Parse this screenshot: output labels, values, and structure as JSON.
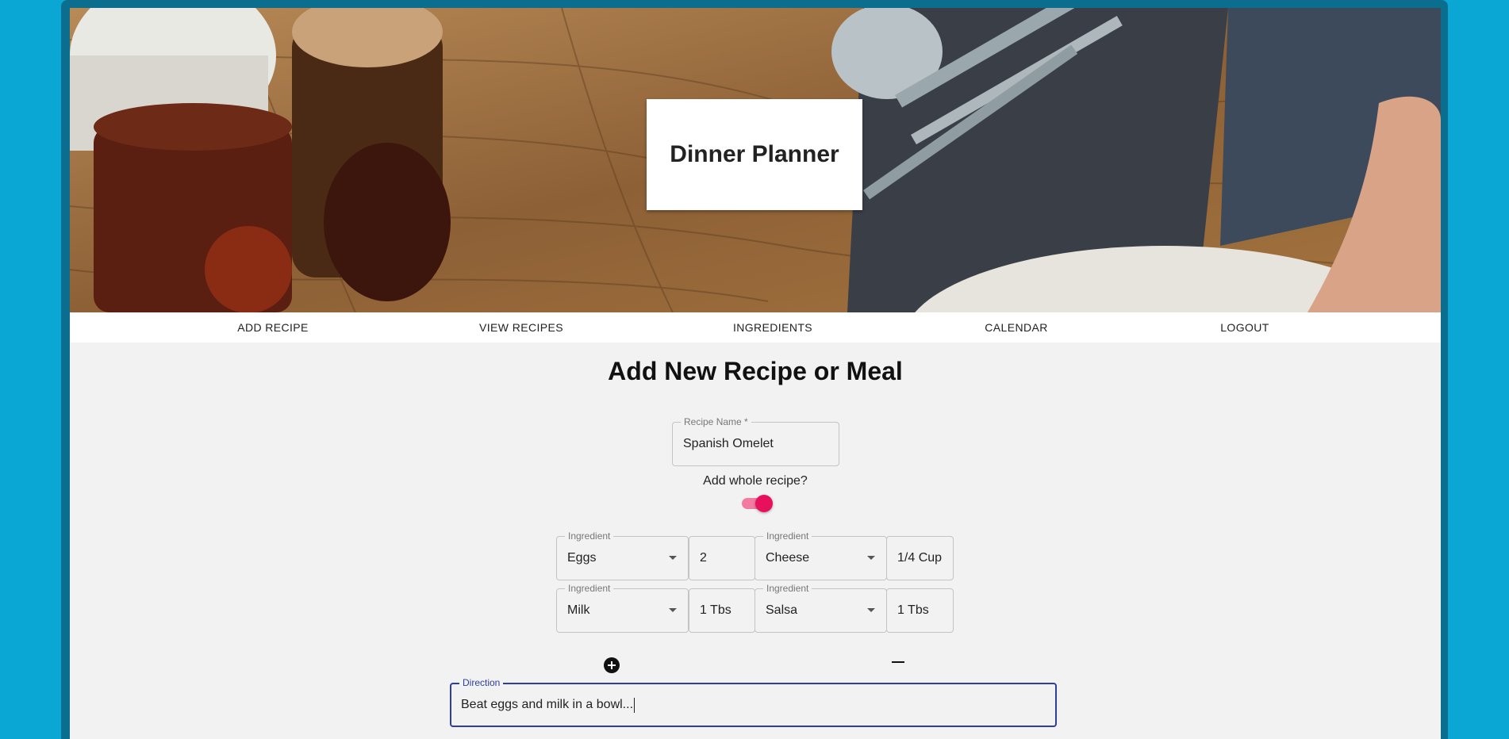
{
  "app": {
    "title": "Dinner Planner"
  },
  "nav": {
    "items": [
      {
        "label": "ADD RECIPE"
      },
      {
        "label": "VIEW RECIPES"
      },
      {
        "label": "INGREDIENTS"
      },
      {
        "label": "CALENDAR"
      },
      {
        "label": "LOGOUT"
      }
    ]
  },
  "form": {
    "heading": "Add New Recipe or Meal",
    "recipe_name": {
      "label": "Recipe Name *",
      "value": "Spanish Omelet"
    },
    "whole_recipe": {
      "label": "Add whole recipe?",
      "checked": true
    },
    "ingredients": [
      {
        "label": "Ingredient",
        "value": "Eggs",
        "amount": "2"
      },
      {
        "label": "Ingredient",
        "value": "Cheese",
        "amount": "1/4 Cup"
      },
      {
        "label": "Ingredient",
        "value": "Milk",
        "amount": "1 Tbs"
      },
      {
        "label": "Ingredient",
        "value": "Salsa",
        "amount": "1 Tbs"
      }
    ],
    "add_icon": "plus-circle-icon",
    "remove_icon": "minus-icon",
    "direction": {
      "label": "Direction",
      "value": "Beat eggs and milk in a bowl..."
    }
  },
  "colors": {
    "background": "#0aa7d4",
    "toggle_accent": "#e8105c",
    "focus_accent": "#2e3fa0"
  }
}
